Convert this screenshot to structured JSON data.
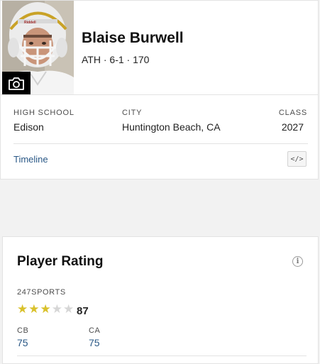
{
  "profile": {
    "name": "Blaise Burwell",
    "meta": "ATH · 6-1 · 170",
    "high_school_label": "HIGH SCHOOL",
    "high_school": "Edison",
    "city_label": "CITY",
    "city": "Huntington Beach, CA",
    "class_label": "CLASS",
    "class_year": "2027",
    "timeline_label": "Timeline",
    "embed_icon": "</>",
    "camera_icon": "camera-icon"
  },
  "rating": {
    "title": "Player Rating",
    "info_icon": "i",
    "source": "247SPORTS",
    "stars_filled": 3,
    "stars_total": 5,
    "score": "87",
    "position_rank_label": "CB",
    "position_rank": "75",
    "state_rank_label": "CA",
    "state_rank": "75"
  },
  "colors": {
    "star_filled": "#d9c12b",
    "star_empty": "#d6d6d6",
    "link": "#2a5886"
  }
}
